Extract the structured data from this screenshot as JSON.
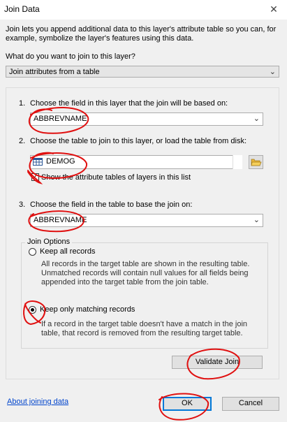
{
  "window": {
    "title": "Join Data"
  },
  "intro_text": "Join lets you append additional data to this layer's attribute table so you can, for example, symbolize the layer's features using this data.",
  "question": "What do you want to join to this layer?",
  "join_type": {
    "value": "Join attributes from a table"
  },
  "step1": {
    "number": "1.",
    "label": "Choose the field in this layer that the join will be based on:",
    "value": "ABBREVNAME"
  },
  "step2": {
    "number": "2.",
    "label": "Choose the table to join to this layer, or load the table from disk:",
    "value": "DEMOG",
    "checkbox_label": "Show the attribute tables of layers in this list"
  },
  "step3": {
    "number": "3.",
    "label": "Choose the field in the table to base the join on:",
    "value": "ABBREVNAME"
  },
  "join_options": {
    "legend": "Join Options",
    "keep_all": {
      "label": "Keep all records",
      "description": "All records in the target table are shown in the resulting table. Unmatched records will contain null values for all fields being appended into the target table from the join table."
    },
    "keep_matching": {
      "label": "Keep only matching records",
      "description": "If a record in the target table doesn't have a match in the join table, that record is removed from the resulting target table."
    }
  },
  "buttons": {
    "validate": "Validate Join",
    "ok": "OK",
    "cancel": "Cancel"
  },
  "link": "About joining data",
  "icons": {
    "close": "close-icon",
    "dropdown": "chevron-down-icon",
    "table": "table-icon",
    "folder": "open-folder-icon"
  },
  "annotation_color": "#e01010",
  "accent_color": "#0078d7"
}
